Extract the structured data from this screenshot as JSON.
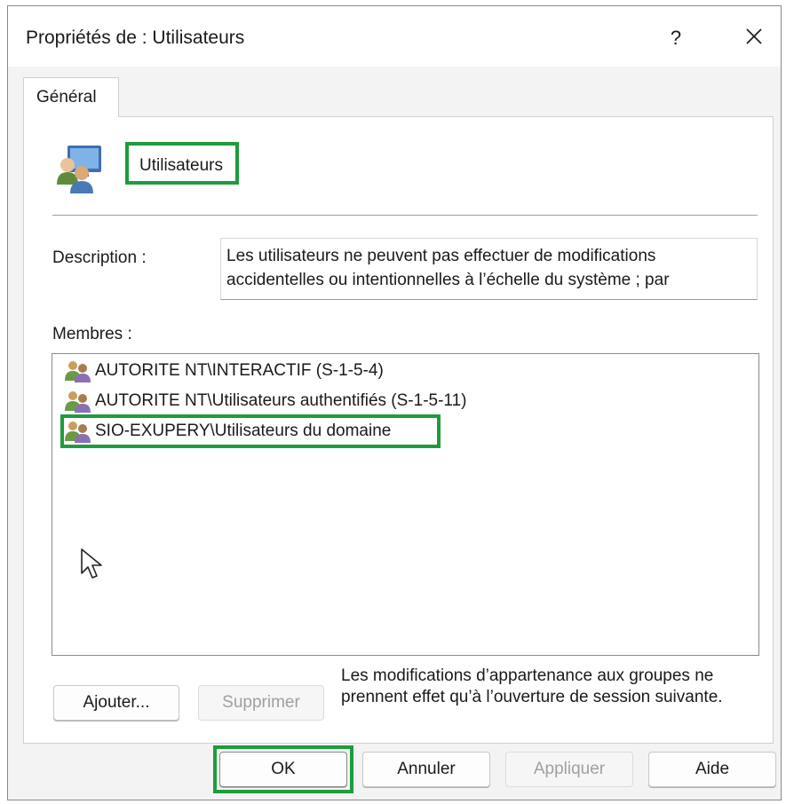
{
  "window": {
    "title": "Propriétés de : Utilisateurs",
    "help_label": "?",
    "close_icon": "close-icon"
  },
  "tabs": [
    {
      "label": "Général",
      "active": true
    }
  ],
  "group": {
    "icon": "group-icon",
    "name": "Utilisateurs"
  },
  "description": {
    "label": "Description :",
    "value": "Les utilisateurs ne peuvent pas effectuer de modifications accidentelles ou intentionnelles à l’échelle du système ; par"
  },
  "members": {
    "label": "Membres :",
    "items": [
      {
        "icon": "group-icon",
        "label": "AUTORITE NT\\INTERACTIF (S-1-5-4)"
      },
      {
        "icon": "group-icon",
        "label": "AUTORITE NT\\Utilisateurs authentifiés (S-1-5-11)"
      },
      {
        "icon": "group-icon",
        "label": "SIO-EXUPERY\\Utilisateurs du domaine"
      }
    ]
  },
  "buttons": {
    "add": "Ajouter...",
    "remove": "Supprimer",
    "ok": "OK",
    "cancel": "Annuler",
    "apply": "Appliquer",
    "help": "Aide"
  },
  "note": "Les modifications d’appartenance aux groupes ne prennent effet qu’à l’ouverture de session suivante.",
  "colors": {
    "highlight": "#1e9c3c",
    "window_bg": "#f3f3f3",
    "disabled_text": "#a0a0a0"
  }
}
